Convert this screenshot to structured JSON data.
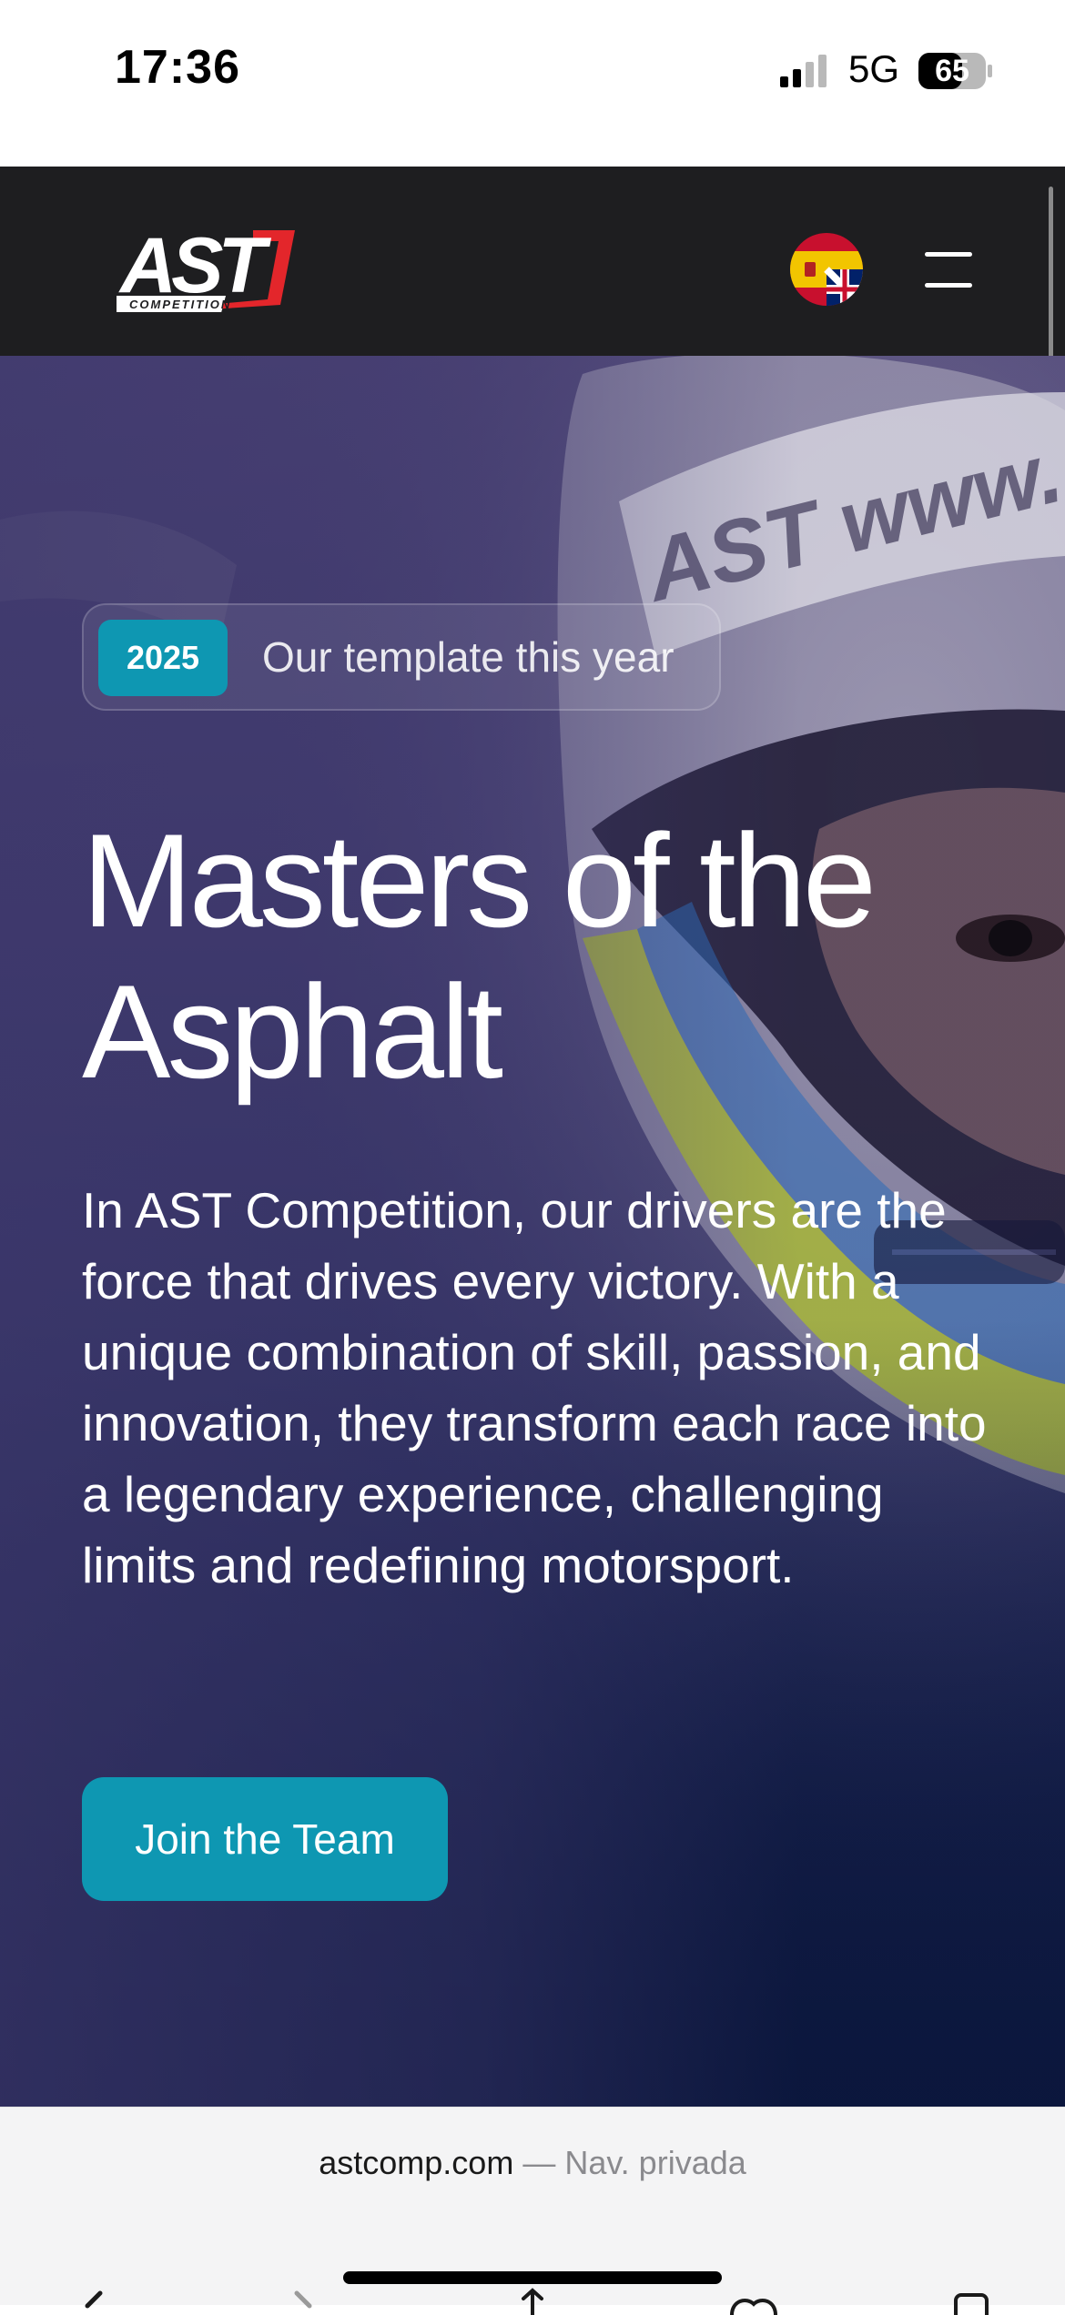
{
  "status_bar": {
    "time": "17:36",
    "network": "5G",
    "battery": "65",
    "icons": [
      "signal-icon",
      "battery-icon"
    ]
  },
  "header": {
    "logo_text": "AST",
    "logo_subtext": "COMPETITION",
    "language_flag": "spain-uk-flag-icon",
    "menu_icon": "hamburger-menu-icon"
  },
  "hero": {
    "badge_year": "2025",
    "badge_text": "Our template this year",
    "title_line1": "Masters of the",
    "title_line2": "Asphalt",
    "description": "In AST Competition, our drivers are the force that drives every victory. With a unique combination of skill, passion, and innovation, they transform each race into a legendary experience, challenging limits and redefining motorsport.",
    "cta_label": "Join the Team"
  },
  "browser": {
    "url": "astcomp.com",
    "private_label": "— Nav. privada"
  },
  "colors": {
    "accent": "#0e97b2",
    "header_bg": "#1e1e20",
    "logo_red": "#e3262b"
  }
}
